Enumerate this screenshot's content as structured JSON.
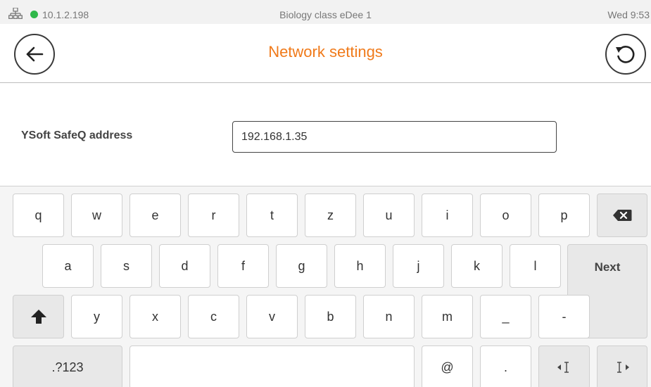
{
  "status_bar": {
    "ip": "10.1.2.198",
    "title": "Biology class eDee 1",
    "time": "Wed 9:53",
    "connection_color": "#2fb84a"
  },
  "header": {
    "title": "Network settings",
    "back_icon": "arrow-left-icon",
    "refresh_icon": "refresh-icon",
    "title_color": "#f07a1a"
  },
  "form": {
    "label": "YSoft SafeQ address",
    "value": "192.168.1.35"
  },
  "keyboard": {
    "row1": [
      "q",
      "w",
      "e",
      "r",
      "t",
      "z",
      "u",
      "i",
      "o",
      "p"
    ],
    "row2": [
      "a",
      "s",
      "d",
      "f",
      "g",
      "h",
      "j",
      "k",
      "l"
    ],
    "row3": [
      "y",
      "x",
      "c",
      "v",
      "b",
      "n",
      "m",
      "_",
      "-"
    ],
    "next": "Next",
    "symbols": ".?123",
    "at": "@",
    "dot": ".",
    "backspace_icon": "backspace-icon",
    "shift_icon": "shift-icon",
    "cursor_left_icon": "cursor-left-icon",
    "cursor_right_icon": "cursor-right-icon"
  }
}
